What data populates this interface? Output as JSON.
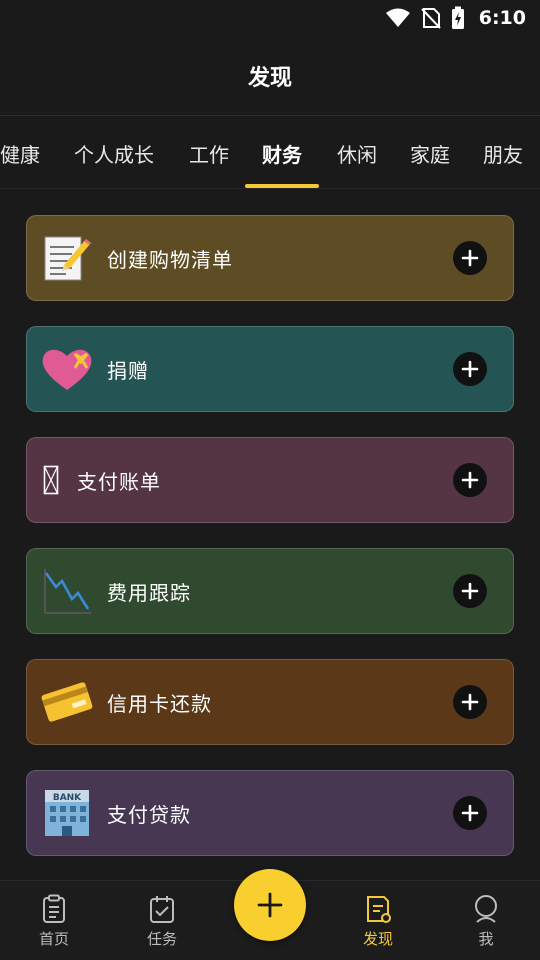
{
  "status_bar": {
    "time": "6:10"
  },
  "header": {
    "title": "发现"
  },
  "tabs": [
    {
      "label": "健康"
    },
    {
      "label": "个人成长"
    },
    {
      "label": "工作"
    },
    {
      "label": "财务",
      "active": true
    },
    {
      "label": "休闲"
    },
    {
      "label": "家庭"
    },
    {
      "label": "朋友"
    }
  ],
  "cards": [
    {
      "label": "创建购物清单",
      "icon": "memo-icon",
      "color": "#5e4d24"
    },
    {
      "label": "捐赠",
      "icon": "heart-ribbon-icon",
      "color": "#255454"
    },
    {
      "label": "支付账单",
      "icon": "missing-glyph-icon",
      "color": "#553444"
    },
    {
      "label": "费用跟踪",
      "icon": "chart-decreasing-icon",
      "color": "#2f4a2f"
    },
    {
      "label": "信用卡还款",
      "icon": "credit-card-icon",
      "color": "#5a3818"
    },
    {
      "label": "支付贷款",
      "icon": "bank-icon",
      "color": "#473752"
    }
  ],
  "bottom_nav": [
    {
      "label": "首页",
      "icon": "home-doc-icon"
    },
    {
      "label": "任务",
      "icon": "calendar-check-icon"
    },
    {
      "label": "发现",
      "icon": "discover-doc-icon",
      "active": true
    },
    {
      "label": "我",
      "icon": "profile-icon"
    }
  ],
  "colors": {
    "accent": "#f5c83a",
    "background": "#1a1a1a"
  }
}
